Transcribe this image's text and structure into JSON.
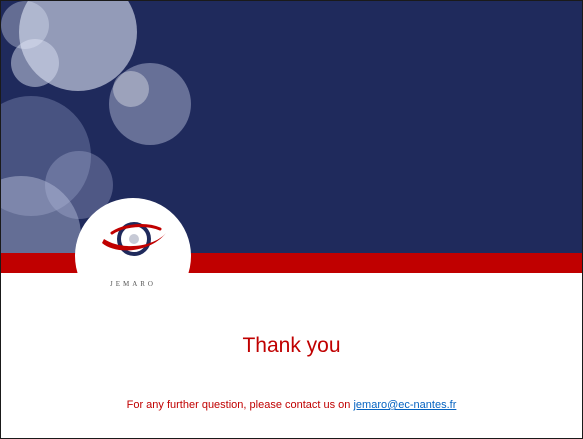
{
  "slide": {
    "title": "Thank you",
    "contact_text": "For any further question, please contact us on ",
    "contact_email": "jemaro@ec-nantes.fr"
  },
  "logo": {
    "wordmark": "JEMARO",
    "icon": "jemaro-globe-icon"
  },
  "colors": {
    "banner_blue": "#1f2a5c",
    "stripe_red": "#c00000",
    "text_red": "#c00000",
    "link_blue": "#0563c1"
  }
}
